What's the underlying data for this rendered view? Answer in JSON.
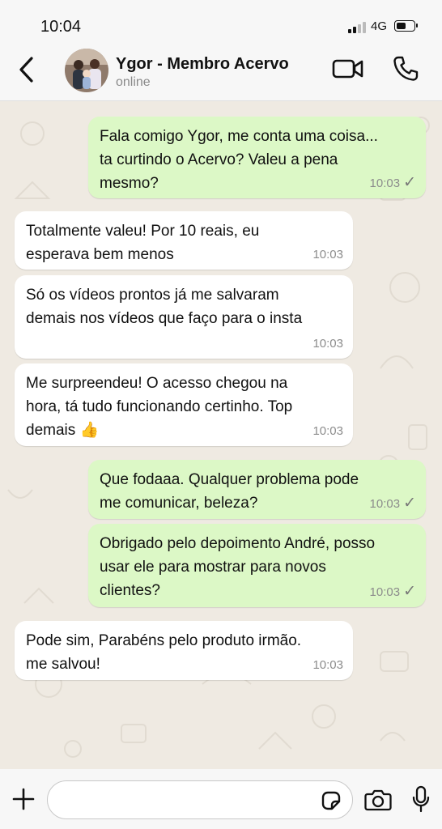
{
  "status_bar": {
    "time": "10:04",
    "network": "4G",
    "battery_level": 0.6
  },
  "header": {
    "contact_name": "Ygor - Membro Acervo",
    "status": "online"
  },
  "messages": [
    {
      "direction": "out",
      "text": "Fala comigo Ygor, me conta uma coisa...\nta curtindo o Acervo? Valeu a pena\nmesmo?",
      "time": "10:03",
      "tick": "✓"
    },
    {
      "direction": "in",
      "text": "Totalmente valeu! Por 10 reais, eu\nesperava bem menos",
      "time": "10:03"
    },
    {
      "direction": "in",
      "text": "Só os vídeos prontos já me salvaram\ndemais nos vídeos que faço para o insta",
      "time": "10:03"
    },
    {
      "direction": "in",
      "text": "Me surpreendeu! O acesso chegou na\nhora, tá tudo funcionando certinho. Top\ndemais 👍",
      "time": "10:03"
    },
    {
      "direction": "out",
      "text": "Que fodaaa. Qualquer problema pode\nme comunicar, beleza?",
      "time": "10:03",
      "tick": "✓"
    },
    {
      "direction": "out",
      "text": "Obrigado pelo depoimento André, posso\nusar ele para mostrar para novos\nclientes?",
      "time": "10:03",
      "tick": "✓"
    },
    {
      "direction": "in",
      "text": "Pode sim, Parabéns pelo produto irmão.\nme salvou!",
      "time": "10:03"
    }
  ],
  "composer": {
    "value": "",
    "placeholder": ""
  },
  "colors": {
    "outgoing_bubble": "#dcf8c6",
    "incoming_bubble": "#ffffff",
    "chat_background": "#efeae2"
  },
  "icons": [
    "back-chevron-icon",
    "video-call-icon",
    "phone-call-icon",
    "plus-icon",
    "sticker-icon",
    "camera-icon",
    "microphone-icon"
  ]
}
